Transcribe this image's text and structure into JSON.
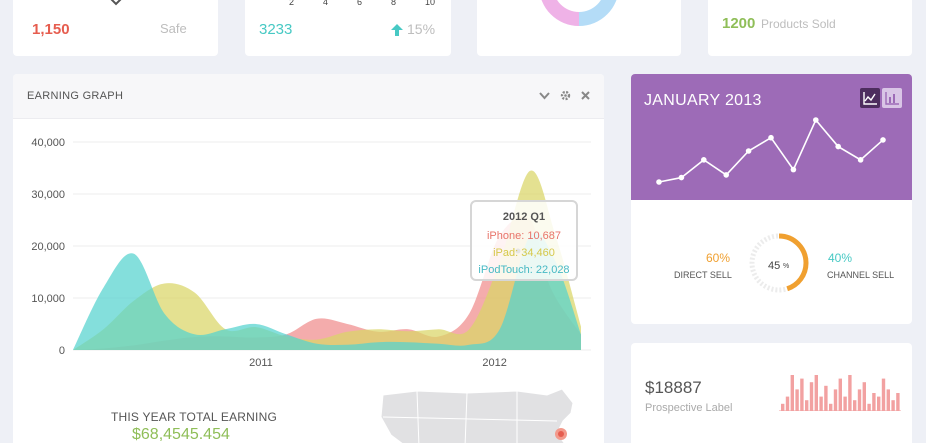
{
  "top_cards": {
    "card1": {
      "value": "1,150",
      "label": "Safe"
    },
    "card2": {
      "ticks": [
        "2",
        "4",
        "6",
        "8",
        "10"
      ],
      "value": "3233",
      "change": "15%"
    },
    "card4": {
      "value": "1200",
      "label": "Products Sold"
    }
  },
  "earning_graph": {
    "title": "EARNING GRAPH",
    "total_label": "THIS YEAR TOTAL EARNING",
    "total_value": "$68,4545.454",
    "tooltip": {
      "title": "2012 Q1",
      "iphone": "iPhone: 10,687",
      "ipad": "iPad: 34,460",
      "ipod": "iPodTouch: 22,028"
    }
  },
  "chart_data": {
    "type": "area",
    "x_tick_labels": [
      "2011",
      "2012"
    ],
    "y_tick_labels": [
      "40,000",
      "30,000",
      "20,000",
      "10,000",
      "0"
    ],
    "ylim": [
      0,
      40000
    ],
    "grid": true,
    "series": [
      {
        "name": "iPhone",
        "color": "#f08c8c",
        "points": [
          [
            0,
            0
          ],
          [
            0.06,
            300
          ],
          [
            0.12,
            900
          ],
          [
            0.18,
            1800
          ],
          [
            0.24,
            2500
          ],
          [
            0.3,
            2600
          ],
          [
            0.36,
            2400
          ],
          [
            0.42,
            3000
          ],
          [
            0.48,
            6000
          ],
          [
            0.54,
            5000
          ],
          [
            0.6,
            3500
          ],
          [
            0.66,
            4000
          ],
          [
            0.72,
            2600
          ],
          [
            0.78,
            7000
          ],
          [
            0.84,
            22000
          ],
          [
            0.9,
            25000
          ],
          [
            0.94,
            12000
          ],
          [
            1,
            3000
          ]
        ]
      },
      {
        "name": "iPad",
        "color": "#d9d566",
        "points": [
          [
            0,
            0
          ],
          [
            0.06,
            4000
          ],
          [
            0.12,
            9500
          ],
          [
            0.18,
            12800
          ],
          [
            0.24,
            11000
          ],
          [
            0.3,
            4000
          ],
          [
            0.36,
            4400
          ],
          [
            0.42,
            2600
          ],
          [
            0.48,
            2000
          ],
          [
            0.54,
            3500
          ],
          [
            0.6,
            4000
          ],
          [
            0.66,
            3600
          ],
          [
            0.72,
            4000
          ],
          [
            0.78,
            4000
          ],
          [
            0.84,
            17000
          ],
          [
            0.9,
            34460
          ],
          [
            0.95,
            22000
          ],
          [
            1,
            4500
          ]
        ]
      },
      {
        "name": "iPodTouch",
        "color": "#54d2cf",
        "points": [
          [
            0,
            0
          ],
          [
            0.06,
            12000
          ],
          [
            0.12,
            18500
          ],
          [
            0.18,
            7000
          ],
          [
            0.24,
            3000
          ],
          [
            0.3,
            4000
          ],
          [
            0.36,
            5000
          ],
          [
            0.42,
            3000
          ],
          [
            0.48,
            1200
          ],
          [
            0.54,
            1000
          ],
          [
            0.6,
            1500
          ],
          [
            0.66,
            1500
          ],
          [
            0.72,
            1200
          ],
          [
            0.78,
            1000
          ],
          [
            0.84,
            4000
          ],
          [
            0.9,
            22028
          ],
          [
            0.95,
            17000
          ],
          [
            1,
            3000
          ]
        ]
      }
    ]
  },
  "january": {
    "title": "JANUARY 2013",
    "line_values": [
      2,
      3,
      7,
      3.6,
      9,
      12,
      4.8,
      16,
      10,
      7,
      11.5
    ],
    "direct_pct": "60%",
    "direct_label": "DIRECT SELL",
    "channel_pct": "40%",
    "channel_label": "CHANNEL SELL",
    "gauge_value": "45",
    "gauge_unit": "%",
    "gauge_fraction": 0.45
  },
  "prospective": {
    "value": "$18887",
    "label": "Prospective Label",
    "bars": [
      2,
      4,
      10,
      6,
      9,
      3,
      8,
      10,
      4,
      7,
      2,
      6,
      9,
      4,
      10,
      3,
      6,
      8,
      2,
      5,
      4,
      9,
      6,
      3,
      5
    ]
  },
  "colors": {
    "accent_purple": "#9d6bb7",
    "orange": "#f0a030",
    "teal": "#47c9c4",
    "red": "#e65d4f",
    "green": "#8fbe58",
    "pink_bars": "#f2a1a1"
  }
}
